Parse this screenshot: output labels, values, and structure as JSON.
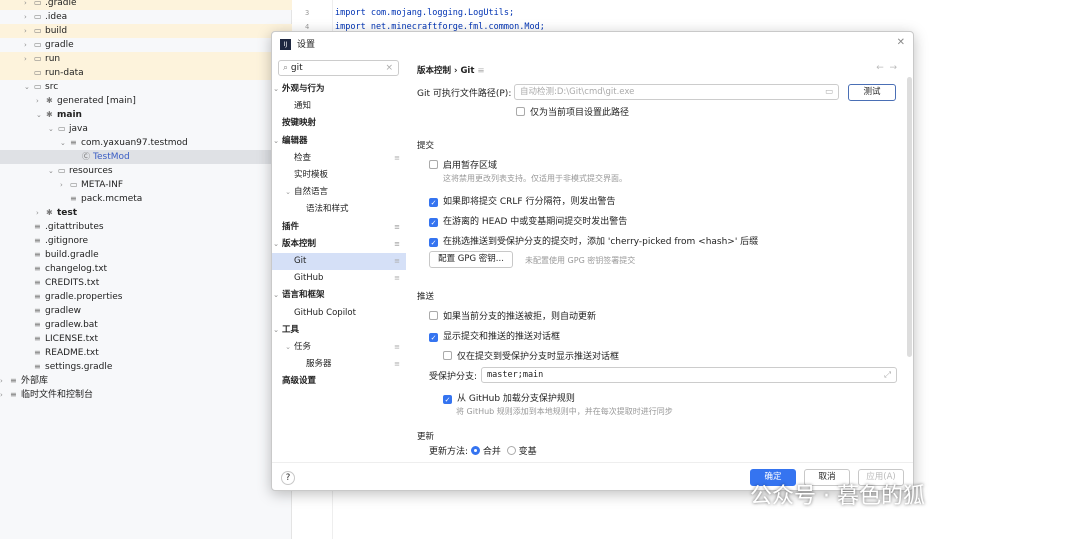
{
  "tree": [
    {
      "label": ".gradle",
      "arrow": "›",
      "icon": "folder-icon",
      "hl": true,
      "indent": 0
    },
    {
      "label": ".idea",
      "arrow": "›",
      "icon": "folder-icon",
      "indent": 0
    },
    {
      "label": "build",
      "arrow": "›",
      "icon": "folder-icon",
      "hl": true,
      "indent": 0
    },
    {
      "label": "gradle",
      "arrow": "›",
      "icon": "folder-icon",
      "indent": 0
    },
    {
      "label": "run",
      "arrow": "›",
      "icon": "folder-icon",
      "hl": true,
      "indent": 0
    },
    {
      "label": "run-data",
      "arrow": "",
      "icon": "folder-icon",
      "hl": true,
      "indent": 0
    },
    {
      "label": "src",
      "arrow": "⌄",
      "icon": "folder-icon",
      "indent": 0
    },
    {
      "label": "generated [main]",
      "arrow": "›",
      "icon": "module-icon",
      "indent": 1
    },
    {
      "label": "main",
      "arrow": "⌄",
      "icon": "module-icon",
      "indent": 1,
      "bold": true
    },
    {
      "label": "java",
      "arrow": "⌄",
      "icon": "folder-icon",
      "indent": 2
    },
    {
      "label": "com.yaxuan97.testmod",
      "arrow": "⌄",
      "icon": "package-icon",
      "indent": 3
    },
    {
      "label": "TestMod",
      "arrow": "",
      "icon": "class-icon",
      "indent": 4,
      "sel": true,
      "blue": true
    },
    {
      "label": "resources",
      "arrow": "⌄",
      "icon": "folder-icon",
      "indent": 2
    },
    {
      "label": "META-INF",
      "arrow": "›",
      "icon": "folder-icon",
      "indent": 3
    },
    {
      "label": "pack.mcmeta",
      "arrow": "",
      "icon": "json-icon",
      "indent": 3
    },
    {
      "label": "test",
      "arrow": "›",
      "icon": "module-icon",
      "indent": 1,
      "bold": true
    },
    {
      "label": ".gitattributes",
      "arrow": "",
      "icon": "text-file-icon",
      "indent": 0
    },
    {
      "label": ".gitignore",
      "arrow": "",
      "icon": "ignore-icon",
      "indent": 0
    },
    {
      "label": "build.gradle",
      "arrow": "",
      "icon": "gradle-icon",
      "indent": 0
    },
    {
      "label": "changelog.txt",
      "arrow": "",
      "icon": "text-file-icon",
      "indent": 0
    },
    {
      "label": "CREDITS.txt",
      "arrow": "",
      "icon": "text-file-icon",
      "indent": 0
    },
    {
      "label": "gradle.properties",
      "arrow": "",
      "icon": "gear-icon",
      "indent": 0
    },
    {
      "label": "gradlew",
      "arrow": "",
      "icon": "script-icon",
      "indent": 0
    },
    {
      "label": "gradlew.bat",
      "arrow": "",
      "icon": "text-file-icon",
      "indent": 0
    },
    {
      "label": "LICENSE.txt",
      "arrow": "",
      "icon": "text-file-icon",
      "indent": 0
    },
    {
      "label": "README.txt",
      "arrow": "",
      "icon": "text-file-icon",
      "indent": 0
    },
    {
      "label": "settings.gradle",
      "arrow": "",
      "icon": "gradle-icon",
      "indent": 0
    },
    {
      "label": "外部库",
      "arrow": "›",
      "icon": "library-icon",
      "indent": -2
    },
    {
      "label": "临时文件和控制台",
      "arrow": "›",
      "icon": "scratch-icon",
      "indent": -2
    }
  ],
  "editor": {
    "lines": [
      {
        "no": "3",
        "code": "import com.mojang.logging.LogUtils;"
      },
      {
        "no": "4",
        "code": "import net.minecraftforge.fml.common.Mod;"
      }
    ]
  },
  "dialog": {
    "title": "设置",
    "search": "git",
    "nav": [
      {
        "label": "外观与行为",
        "bold": true,
        "arrow": "⌄",
        "lvl": 0
      },
      {
        "label": "通知",
        "lvl": 1
      },
      {
        "label": "按键映射",
        "bold": true,
        "lvl": 0
      },
      {
        "label": "编辑器",
        "bold": true,
        "arrow": "⌄",
        "lvl": 0
      },
      {
        "label": "检查",
        "lvl": 1,
        "mark": true
      },
      {
        "label": "实时模板",
        "lvl": 1
      },
      {
        "label": "自然语言",
        "arrow": "⌄",
        "lvl": 1
      },
      {
        "label": "语法和样式",
        "lvl": 2
      },
      {
        "label": "插件",
        "bold": true,
        "lvl": 0,
        "mark": true
      },
      {
        "label": "版本控制",
        "bold": true,
        "arrow": "⌄",
        "lvl": 0,
        "mark": true
      },
      {
        "label": "Git",
        "lvl": 1,
        "mark": true,
        "sel": true
      },
      {
        "label": "GitHub",
        "lvl": 1,
        "mark": true
      },
      {
        "label": "语言和框架",
        "bold": true,
        "arrow": "⌄",
        "lvl": 0
      },
      {
        "label": "GitHub Copilot",
        "lvl": 1
      },
      {
        "label": "工具",
        "bold": true,
        "arrow": "⌄",
        "lvl": 0
      },
      {
        "label": "任务",
        "arrow": "⌄",
        "lvl": 1,
        "mark": true
      },
      {
        "label": "服务器",
        "lvl": 2,
        "mark": true
      },
      {
        "label": "高级设置",
        "bold": true,
        "lvl": 0
      }
    ],
    "breadcrumb": {
      "parent": "版本控制",
      "current": "Git"
    },
    "git_path_label": "Git 可执行文件路径(P):",
    "git_path_placeholder": "自动检测:D:\\Git\\cmd\\git.exe",
    "test_button": "测试",
    "project_only": "仅为当前项目设置此路径",
    "commit": {
      "title": "提交",
      "staging": "启用暂存区域",
      "staging_hint": "这将禁用更改列表支持。仅适用于非模式提交界面。",
      "crlf": "如果即将提交 CRLF 行分隔符，则发出警告",
      "head": "在游离的 HEAD 中或变基期间提交时发出警告",
      "cherry": "在挑选推送到受保护分支的提交时，添加 'cherry-picked from <hash>' 后缀",
      "gpg_button": "配置 GPG 密钥...",
      "gpg_hint": "未配置使用 GPG 密钥签署提交"
    },
    "push": {
      "title": "推送",
      "auto_update": "如果当前分支的推送被拒，则自动更新",
      "show_dialog": "显示提交和推送的推送对话框",
      "protected_only": "仅在提交到受保护分支时显示推送对话框",
      "protected_label": "受保护分支:",
      "protected_value": "master;main",
      "load_github": "从 GitHub 加载分支保护规则",
      "load_github_hint": "将 GitHub 规则添加到本地规则中，并在每次提取时进行同步"
    },
    "update": {
      "title": "更新",
      "method_label": "更新方法:",
      "merge": "合并",
      "rebase": "变基"
    },
    "ok": "确定",
    "cancel": "取消",
    "apply": "应用(A)",
    "help": "?"
  },
  "watermark": "公众号 · 暮色的狐",
  "accent": "#3574f0"
}
